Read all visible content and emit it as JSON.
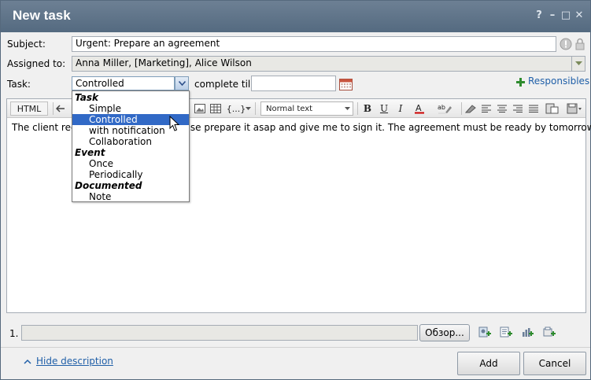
{
  "window": {
    "title": "New task",
    "controls": {
      "help": "?",
      "minimize": "–",
      "maximize": "□",
      "close": "✕"
    }
  },
  "form": {
    "subject_label": "Subject:",
    "subject_value": "Urgent: Prepare an agreement",
    "assigned_label": "Assigned to:",
    "assigned_value": "Anna Miller, [Marketing], Alice Wilson",
    "task_label": "Task:",
    "task_value": "Controlled",
    "complete_till_label": "complete till",
    "complete_till_value": "",
    "responsibles_label": "Responsibles"
  },
  "editor": {
    "html_label": "HTML",
    "format_value": "Normal text",
    "insert_label": "{...}",
    "body_text": "The client requested the agreement to be prepared. Please prepare it asap and give me to sign it. The agreement must be ready by tomorrow.",
    "visible_left": "The client req",
    "visible_right": "ase prepare it asap and give me to sign it. The agreement must be ready by tomorrow."
  },
  "task_dropdown": {
    "groups": [
      {
        "label": "Task",
        "options": [
          "Simple",
          "Controlled",
          "with notification",
          "Collaboration"
        ]
      },
      {
        "label": "Event",
        "options": [
          "Once",
          "Periodically"
        ]
      },
      {
        "label": "Documented",
        "options": [
          "Note"
        ]
      }
    ],
    "selected": "Controlled"
  },
  "attachment": {
    "index": "1.",
    "file_value": "",
    "browse_label": "Обзор..."
  },
  "footer": {
    "hide_description_label": "Hide description",
    "add_label": "Add",
    "cancel_label": "Cancel"
  },
  "colors": {
    "titlebar": "#5f7388",
    "accent_link": "#1f5fa8",
    "selection": "#3169c6",
    "add_icon_green": "#2e8b2e"
  }
}
